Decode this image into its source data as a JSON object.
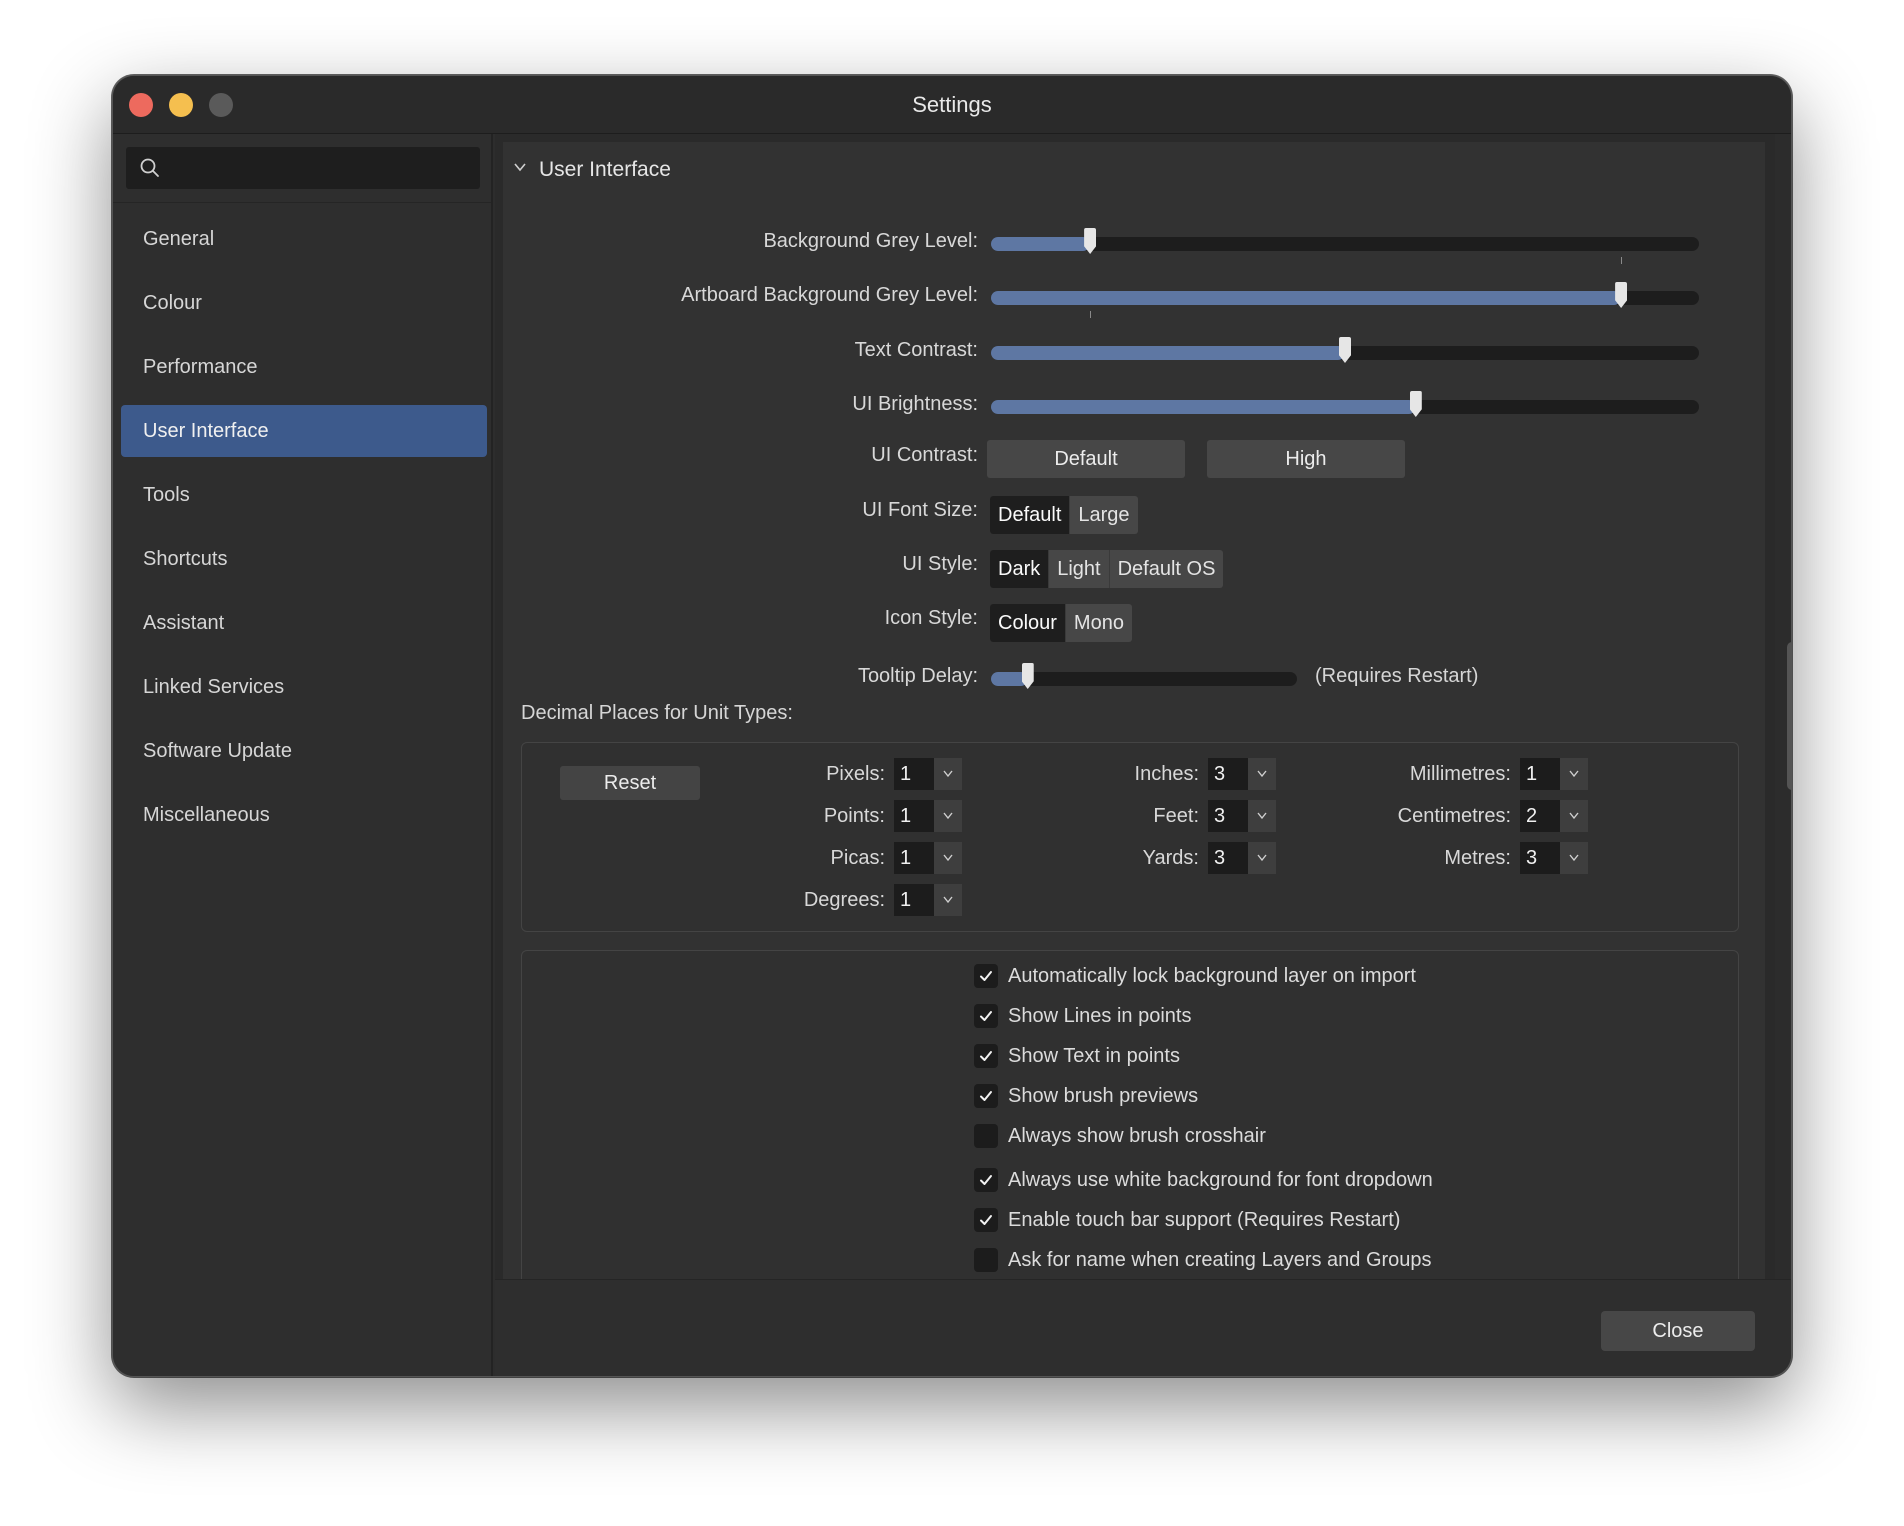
{
  "window": {
    "title": "Settings"
  },
  "search": {
    "placeholder": "",
    "icon": "search-icon"
  },
  "sidebar": {
    "items": [
      {
        "label": "General",
        "active": false
      },
      {
        "label": "Colour",
        "active": false
      },
      {
        "label": "Performance",
        "active": false
      },
      {
        "label": "User Interface",
        "active": true
      },
      {
        "label": "Tools",
        "active": false
      },
      {
        "label": "Shortcuts",
        "active": false
      },
      {
        "label": "Assistant",
        "active": false
      },
      {
        "label": "Linked Services",
        "active": false
      },
      {
        "label": "Software Update",
        "active": false
      },
      {
        "label": "Miscellaneous",
        "active": false
      }
    ]
  },
  "section": {
    "title": "User Interface",
    "expanded": true
  },
  "sliders": [
    {
      "label": "Background Grey Level:",
      "value": 0.14
    },
    {
      "label": "Artboard Background Grey Level:",
      "value": 0.89
    },
    {
      "label": "Text Contrast:",
      "value": 0.5
    },
    {
      "label": "UI Brightness:",
      "value": 0.6
    }
  ],
  "ui_contrast": {
    "label": "UI Contrast:",
    "options": [
      "Default",
      "High"
    ]
  },
  "ui_font_size": {
    "label": "UI Font Size:",
    "options": [
      "Default",
      "Large"
    ],
    "selected": "Default"
  },
  "ui_style": {
    "label": "UI Style:",
    "options": [
      "Dark",
      "Light",
      "Default OS"
    ],
    "selected": "Dark"
  },
  "icon_style": {
    "label": "Icon Style:",
    "options": [
      "Colour",
      "Mono"
    ],
    "selected": "Colour"
  },
  "tooltip_delay": {
    "label": "Tooltip Delay:",
    "value": 0.12,
    "note": "(Requires Restart)"
  },
  "decimal_places": {
    "title": "Decimal Places for Unit Types:",
    "reset_label": "Reset",
    "units": [
      {
        "label": "Pixels:",
        "value": "1"
      },
      {
        "label": "Points:",
        "value": "1"
      },
      {
        "label": "Picas:",
        "value": "1"
      },
      {
        "label": "Degrees:",
        "value": "1"
      },
      {
        "label": "Inches:",
        "value": "3"
      },
      {
        "label": "Feet:",
        "value": "3"
      },
      {
        "label": "Yards:",
        "value": "3"
      },
      {
        "label": "Millimetres:",
        "value": "1"
      },
      {
        "label": "Centimetres:",
        "value": "2"
      },
      {
        "label": "Metres:",
        "value": "3"
      }
    ]
  },
  "options": [
    {
      "label": "Automatically lock background layer on import",
      "checked": true
    },
    {
      "label": "Show Lines in points",
      "checked": true
    },
    {
      "label": "Show Text in points",
      "checked": true
    },
    {
      "label": "Show brush previews",
      "checked": true
    },
    {
      "label": "Always show brush crosshair",
      "checked": false
    },
    {
      "label": "Always use white background for font dropdown",
      "checked": true
    },
    {
      "label": "Enable touch bar support (Requires Restart)",
      "checked": true
    },
    {
      "label": "Ask for name when creating Layers and Groups",
      "checked": false
    }
  ],
  "footer": {
    "close_label": "Close"
  },
  "colors": {
    "accent": "#3d5a8c",
    "slider_fill": "#5e77a3",
    "background": "#2d2d2d"
  }
}
